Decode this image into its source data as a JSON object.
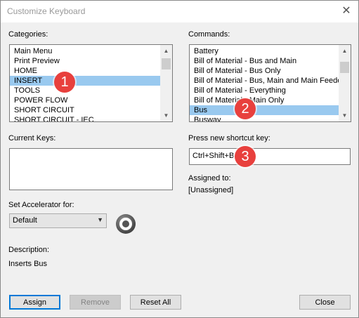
{
  "window": {
    "title": "Customize Keyboard",
    "close_icon": "close-icon"
  },
  "categories": {
    "label": "Categories:",
    "items": [
      "Main Menu",
      "Print Preview",
      "HOME",
      "INSERT",
      "TOOLS",
      "POWER FLOW",
      "SHORT CIRCUIT",
      "SHORT CIRCUIT - IEC"
    ],
    "selected": "INSERT"
  },
  "commands": {
    "label": "Commands:",
    "items": [
      "Battery",
      "Bill of Material - Bus and Main",
      "Bill of Material - Bus Only",
      "Bill of Material - Bus, Main and Main Feeder",
      "Bill of Material - Everything",
      "Bill of Material - Main Only",
      "Bus",
      "Busway"
    ],
    "selected": "Bus"
  },
  "current_keys": {
    "label": "Current Keys:"
  },
  "shortcut": {
    "label": "Press new shortcut key:",
    "value": "Ctrl+Shift+B"
  },
  "assigned": {
    "label": "Assigned to:",
    "value": "[Unassigned]"
  },
  "accelerator": {
    "label": "Set Accelerator for:",
    "value": "Default"
  },
  "description": {
    "label": "Description:",
    "text": "Inserts Bus"
  },
  "buttons": {
    "assign": "Assign",
    "remove": "Remove",
    "reset_all": "Reset All",
    "close": "Close"
  },
  "markers": [
    "1",
    "2",
    "3"
  ],
  "colors": {
    "selection": "#99c9ef",
    "marker": "#e8403d",
    "default_button_border": "#0078d7"
  }
}
